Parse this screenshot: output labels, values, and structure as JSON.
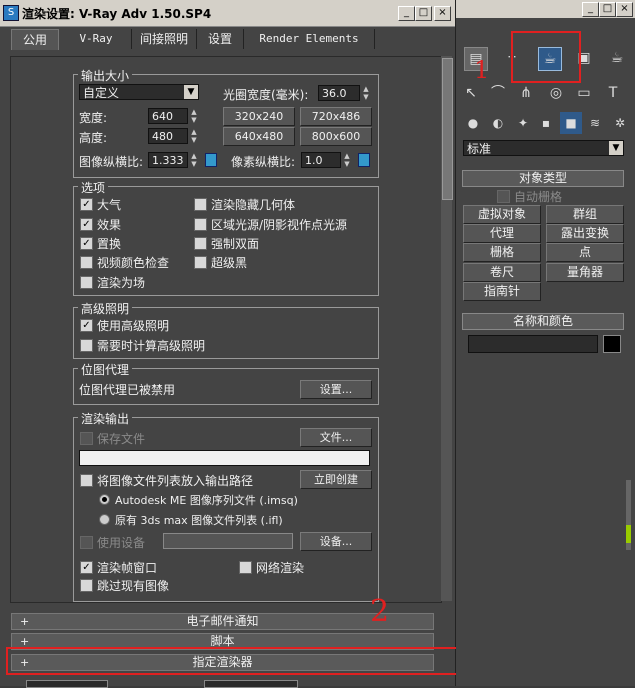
{
  "window": {
    "title": "渲染设置: V-Ray Adv 1.50.SP4",
    "min": "_",
    "max": "□",
    "close": "×"
  },
  "tabs": [
    {
      "label": "公用"
    },
    {
      "label": "V-Ray"
    },
    {
      "label": "间接照明"
    },
    {
      "label": "设置"
    },
    {
      "label": "Render Elements"
    }
  ],
  "output_size": {
    "title": "输出大小",
    "preset": "自定义",
    "aperture_label": "光圈宽度(毫米):",
    "aperture_value": "36.0",
    "width_label": "宽度:",
    "width_value": "640",
    "height_label": "高度:",
    "height_value": "480",
    "presets": [
      "320x240",
      "720x486",
      "640x480",
      "800x600"
    ],
    "image_aspect_label": "图像纵横比:",
    "image_aspect_value": "1.333",
    "pixel_aspect_label": "像素纵横比:",
    "pixel_aspect_value": "1.0"
  },
  "options": {
    "title": "选项",
    "left": [
      {
        "label": "大气",
        "checked": true
      },
      {
        "label": "效果",
        "checked": true
      },
      {
        "label": "置换",
        "checked": true
      },
      {
        "label": "视频颜色检查",
        "checked": false
      },
      {
        "label": "渲染为场",
        "checked": false
      }
    ],
    "right": [
      {
        "label": "渲染隐藏几何体",
        "checked": false
      },
      {
        "label": "区域光源/阴影视作点光源",
        "checked": false
      },
      {
        "label": "强制双面",
        "checked": false
      },
      {
        "label": "超级黑",
        "checked": false
      }
    ]
  },
  "advanced_lighting": {
    "title": "高级照明",
    "items": [
      {
        "label": "使用高级照明",
        "checked": true
      },
      {
        "label": "需要时计算高级照明",
        "checked": false
      }
    ]
  },
  "bitmap_proxy": {
    "title": "位图代理",
    "status": "位图代理已被禁用",
    "settings_button": "设置..."
  },
  "render_output": {
    "title": "渲染输出",
    "save_file": "保存文件",
    "files_button": "文件...",
    "put_list_label": "将图像文件列表放入输出路径",
    "create_now": "立即创建",
    "radio1": "Autodesk ME 图像序列文件 (.imsq)",
    "radio2": "原有 3ds max 图像文件列表 (.ifl)",
    "use_device": "使用设备",
    "devices_button": "设备...",
    "frame_window": "渲染帧窗口",
    "net_render": "网络渲染",
    "skip_existing": "跳过现有图像"
  },
  "rollouts": [
    {
      "label": "电子邮件通知"
    },
    {
      "label": "脚本"
    },
    {
      "label": "指定渲染器"
    }
  ],
  "annotations": {
    "one": "1",
    "two": "2"
  },
  "right_panel": {
    "dropdown": "标准",
    "object_type_title": "对象类型",
    "autogrid": "自动栅格",
    "buttons": [
      "虚拟对象",
      "群组",
      "代理",
      "露出变换",
      "栅格",
      "点",
      "卷尺",
      "量角器",
      "指南针"
    ],
    "name_color_title": "名称和颜色"
  },
  "colors": {
    "accent_red": "#e02020",
    "panel_bg": "#444444"
  }
}
